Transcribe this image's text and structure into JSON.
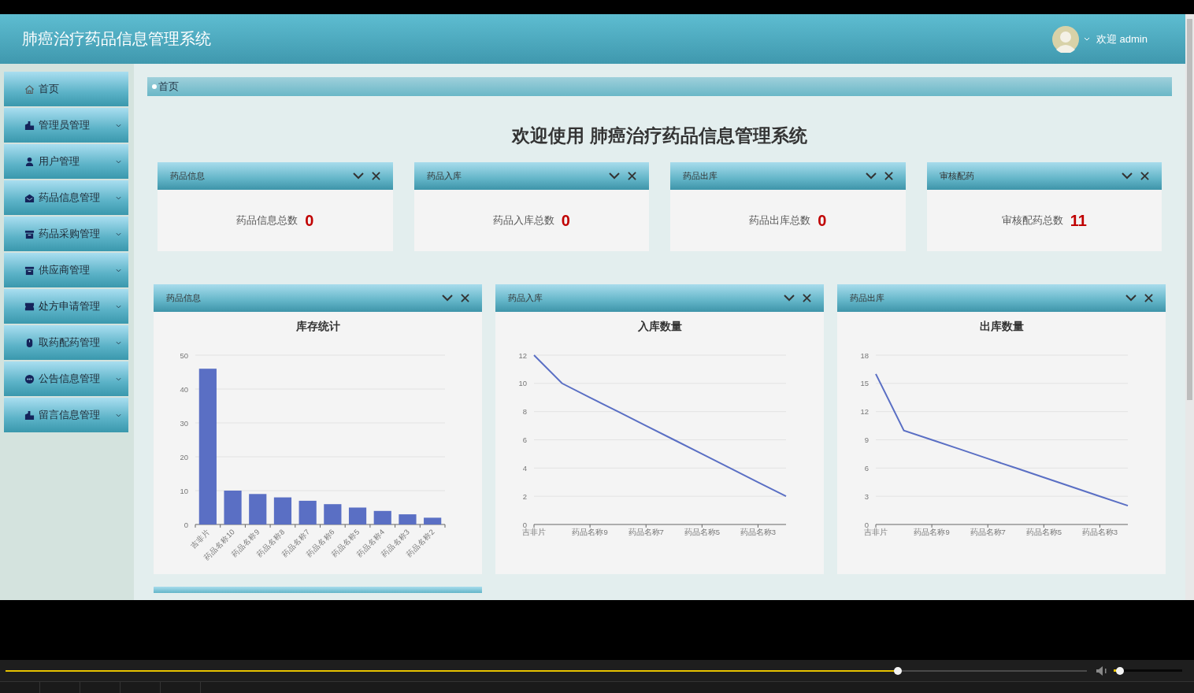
{
  "header": {
    "title": "肺癌治疗药品信息管理系统",
    "greeting": "欢迎 admin"
  },
  "sidebar": {
    "items": [
      {
        "label": "首页",
        "has_submenu": false
      },
      {
        "label": "管理员管理",
        "has_submenu": true
      },
      {
        "label": "用户管理",
        "has_submenu": true
      },
      {
        "label": "药品信息管理",
        "has_submenu": true
      },
      {
        "label": "药品采购管理",
        "has_submenu": true
      },
      {
        "label": "供应商管理",
        "has_submenu": true
      },
      {
        "label": "处方申请管理",
        "has_submenu": true
      },
      {
        "label": "取药配药管理",
        "has_submenu": true
      },
      {
        "label": "公告信息管理",
        "has_submenu": true
      },
      {
        "label": "留言信息管理",
        "has_submenu": true
      }
    ]
  },
  "breadcrumb": {
    "label": "首页"
  },
  "welcome_title": "欢迎使用 肺癌治疗药品信息管理系统",
  "stat_cards": [
    {
      "title": "药品信息",
      "label": "药品信息总数",
      "value": "0"
    },
    {
      "title": "药品入库",
      "label": "药品入库总数",
      "value": "0"
    },
    {
      "title": "药品出库",
      "label": "药品出库总数",
      "value": "0"
    },
    {
      "title": "审核配药",
      "label": "审核配药总数",
      "value": "11"
    }
  ],
  "chart_panels": [
    {
      "title": "药品信息",
      "chart_data": {
        "type": "bar",
        "title": "库存统计",
        "categories": [
          "吉非片",
          "药品名称10",
          "药品名称9",
          "药品名称8",
          "药品名称7",
          "药品名称6",
          "药品名称5",
          "药品名称4",
          "药品名称3",
          "药品名称2"
        ],
        "values": [
          46,
          10,
          9,
          8,
          7,
          6,
          5,
          4,
          3,
          2
        ],
        "grid": true,
        "ylim": [
          0,
          50
        ],
        "yticks": [
          0,
          10,
          20,
          30,
          40,
          50
        ]
      }
    },
    {
      "title": "药品入库",
      "chart_data": {
        "type": "line",
        "title": "入库数量",
        "categories": [
          "吉非片",
          null,
          "药品名称9",
          null,
          "药品名称7",
          null,
          "药品名称5",
          null,
          "药品名称3",
          null
        ],
        "values": [
          12,
          10,
          9,
          8,
          7,
          6,
          5,
          4,
          3,
          2
        ],
        "grid": true,
        "ylim": [
          0,
          12
        ],
        "yticks": [
          0,
          2,
          4,
          6,
          8,
          10,
          12
        ]
      }
    },
    {
      "title": "药品出库",
      "chart_data": {
        "type": "line",
        "title": "出库数量",
        "categories": [
          "吉非片",
          null,
          "药品名称9",
          null,
          "药品名称7",
          null,
          "药品名称5",
          null,
          "药品名称3",
          null
        ],
        "values": [
          16,
          10,
          9,
          8,
          7,
          6,
          5,
          4,
          3,
          2
        ],
        "grid": true,
        "ylim": [
          0,
          18
        ],
        "yticks": [
          0,
          3,
          6,
          9,
          12,
          15,
          18
        ]
      }
    }
  ],
  "player": {
    "seek": {
      "level": 0.825
    },
    "volume": {
      "level": 0.09
    }
  }
}
